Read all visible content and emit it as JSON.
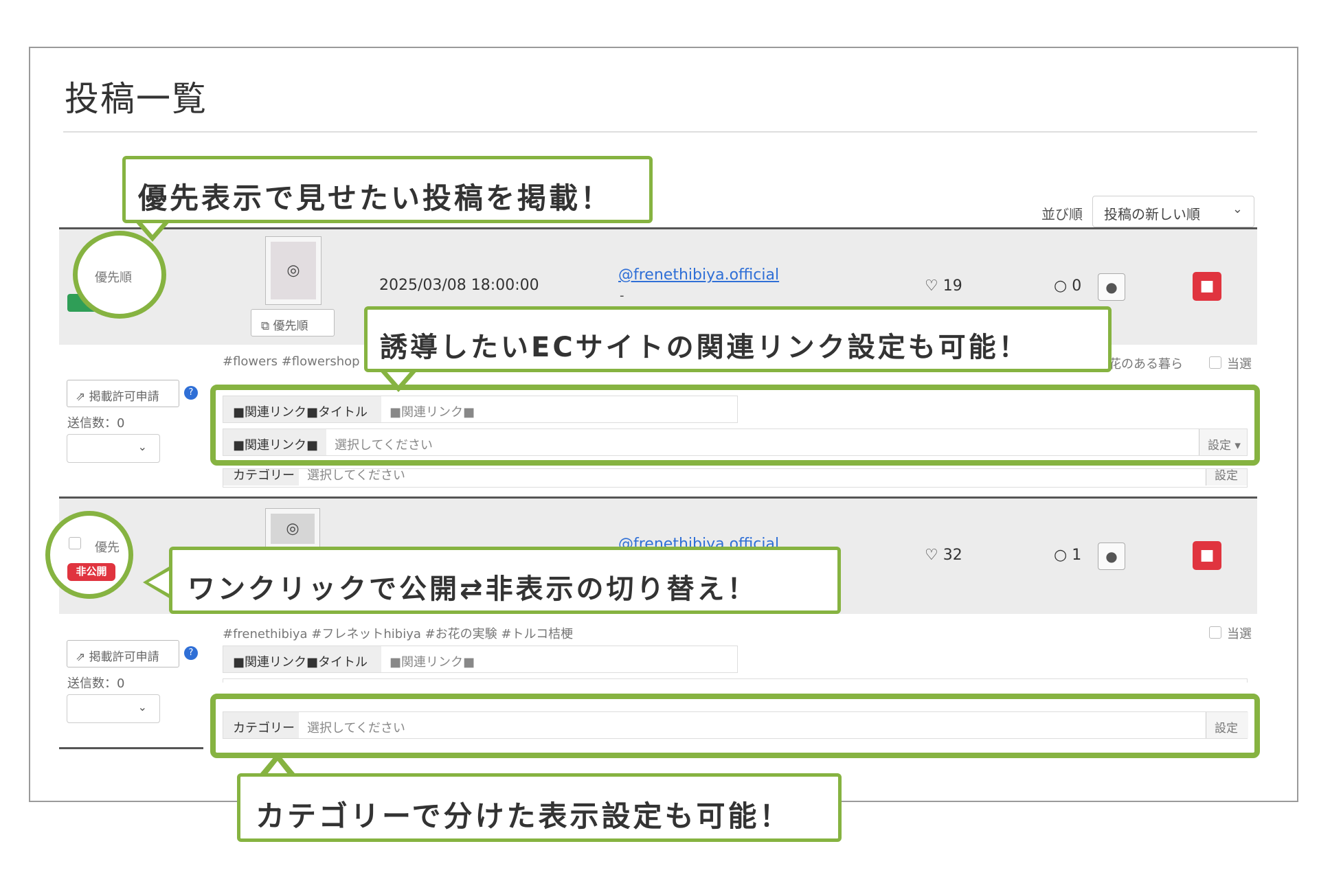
{
  "page": {
    "title": "投稿一覧"
  },
  "sort": {
    "label": "並び順",
    "value": "投稿の新しい順"
  },
  "posts": [
    {
      "priority_label": "優先順",
      "priority_button": "優先順",
      "datetime": "2025/03/08 18:00:00",
      "account": "@frenethibiya.official",
      "account_sub": "-",
      "likes": "19",
      "comments": "0",
      "apply_button": "掲載許可申請",
      "sent_count": "送信数：0",
      "tags": "#flowers #flowershop",
      "tags_tail": "花のある暮ら",
      "check_label": "当選",
      "related_title_key": "■関連リンク■タイトル",
      "related_title_val": "■関連リンク■",
      "related_link_key": "■関連リンク■",
      "related_link_val": "選択してください",
      "set_button": "設定",
      "category_key": "カテゴリー",
      "category_val": "選択してください",
      "category_set": "設定"
    },
    {
      "priority_label": "優先",
      "status_badge": "非公開",
      "account": "@frenethibiya.official",
      "likes": "32",
      "comments": "1",
      "apply_button": "掲載許可申請",
      "sent_count": "送信数：0",
      "tags": "#frenethibiya #フレネットhibiya #お花の実験 #トルコ桔梗",
      "check_label": "当選",
      "related_title_key": "■関連リンク■タイトル",
      "related_title_val": "■関連リンク■",
      "category_key": "カテゴリー",
      "category_val": "選択してください",
      "set_button": "設定"
    }
  ],
  "callouts": {
    "priority": "優先表示で見せたい投稿を掲載！",
    "ec_link": "誘導したいECサイトの関連リンク設定も可能！",
    "toggle": "ワンクリックで公開⇄非表示の切り替え！",
    "category": "カテゴリーで分けた表示設定も可能！"
  },
  "colors": {
    "accent_green": "#86b341",
    "delete_red": "#e0343f",
    "link_blue": "#2f6fd6",
    "badge_green": "#2f9e57"
  },
  "icons": [
    "heart-icon",
    "comment-icon",
    "user-icon",
    "trash-icon",
    "share-icon",
    "help-icon",
    "chevron-down-icon",
    "camera-icon"
  ]
}
